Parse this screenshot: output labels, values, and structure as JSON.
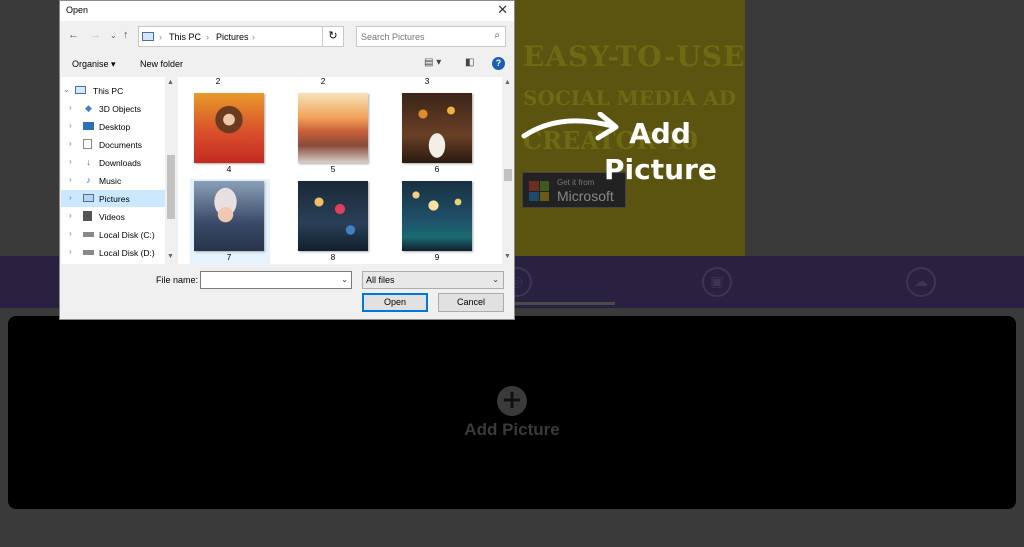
{
  "dialog": {
    "title": "Open",
    "close_glyph": "✕",
    "nav": {
      "back_icon": "arrow-left-icon",
      "forward_icon": "arrow-right-icon",
      "recent_icon": "chevron-down-icon",
      "up_icon": "arrow-up-icon"
    },
    "address": {
      "crumbs": [
        "This PC",
        "Pictures"
      ],
      "separator": "›"
    },
    "search_placeholder": "Search Pictures",
    "commands": {
      "organise": "Organise ▾",
      "new_folder": "New folder"
    },
    "tree": [
      {
        "label": "This PC",
        "icon": "computer-icon",
        "root": true
      },
      {
        "label": "3D Objects",
        "icon": "cube-icon"
      },
      {
        "label": "Desktop",
        "icon": "desktop-icon"
      },
      {
        "label": "Documents",
        "icon": "document-icon"
      },
      {
        "label": "Downloads",
        "icon": "download-icon"
      },
      {
        "label": "Music",
        "icon": "music-icon"
      },
      {
        "label": "Pictures",
        "icon": "pictures-icon",
        "selected": true
      },
      {
        "label": "Videos",
        "icon": "video-icon"
      },
      {
        "label": "Local Disk (C:)",
        "icon": "disk-icon"
      },
      {
        "label": "Local Disk (D:)",
        "icon": "disk-icon"
      }
    ],
    "files": {
      "top_partial_labels": [
        "2",
        "2",
        "3"
      ],
      "rows": [
        {
          "labels": [
            "4",
            "5",
            "6"
          ]
        },
        {
          "labels": [
            "7",
            "8",
            "9"
          ]
        }
      ],
      "selected": "7"
    },
    "file_name_label": "File name:",
    "file_name_value": "",
    "filter_value": "All files",
    "open_label": "Open",
    "cancel_label": "Cancel"
  },
  "background": {
    "banner_lines": [
      "EASY-TO-USE",
      "SOCIAL MEDIA AD",
      "CREATOR 10"
    ],
    "store_badge_small": "Get it from",
    "store_badge_big": "Microsoft",
    "add_picture_label": "Add Picture",
    "add_plus_glyph": "+"
  },
  "annotation": {
    "line1": "Add",
    "line2": "Picture"
  },
  "colors": {
    "accent": "#0078d7",
    "selection": "#cce8ff",
    "panel": "#000000",
    "toolbar": "#2a2140"
  }
}
